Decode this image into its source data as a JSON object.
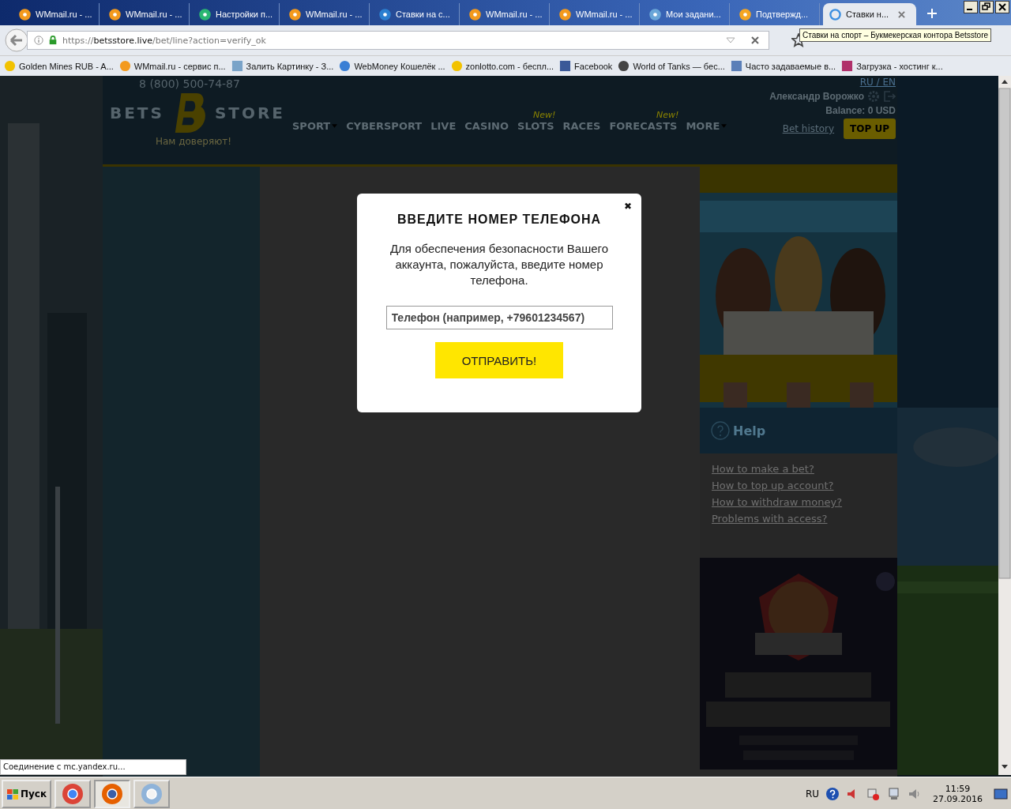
{
  "browser": {
    "tabs": [
      {
        "title": "WMmail.ru - ...",
        "kind": "mail",
        "selected": false
      },
      {
        "title": "WMmail.ru - ...",
        "kind": "mail",
        "selected": false
      },
      {
        "title": "Настройки п...",
        "kind": "paw",
        "selected": false
      },
      {
        "title": "WMmail.ru - ...",
        "kind": "mail",
        "selected": false
      },
      {
        "title": "Ставки на с...",
        "kind": "bets",
        "selected": false
      },
      {
        "title": "WMmail.ru - ...",
        "kind": "mail",
        "selected": false
      },
      {
        "title": "WMmail.ru - ...",
        "kind": "mail",
        "selected": false
      },
      {
        "title": "Мои задани...",
        "kind": "target",
        "selected": false
      },
      {
        "title": "Подтвержд...",
        "kind": "mailbox",
        "selected": false
      },
      {
        "title": "Ставки н...",
        "kind": "loading",
        "selected": true
      }
    ],
    "address": {
      "url": "https://**betsstore.live**/bet/line?action=verify_ok"
    },
    "tooltip": "Ставки на спорт – Букмекерская контора Betsstore",
    "bookmarks": [
      {
        "title": "Golden Mines RUB - A...",
        "kind": "coin"
      },
      {
        "title": "WMmail.ru - сервис п...",
        "kind": "mail"
      },
      {
        "title": "Залить Картинку - З..."
      },
      {
        "title": "WebMoney Кошелёк ...",
        "kind": "globe"
      },
      {
        "title": "zonlotto.com - беспл...",
        "kind": "coin"
      },
      {
        "title": "Facebook",
        "kind": "facebook"
      },
      {
        "title": "World of Tanks — бес...",
        "kind": "shield"
      },
      {
        "title": "Часто задаваемые в...",
        "kind": "columns"
      },
      {
        "title": "Загрузка - хостинг к...",
        "kind": "stripes"
      }
    ],
    "status": "Соединение с mc.yandex.ru..."
  },
  "site": {
    "header": {
      "phone": "8 (800) 500-74-87",
      "logo_left": "BETS",
      "logo_right": "STORE",
      "tagline": "Нам доверяют!",
      "nav": [
        {
          "label": "SPORT",
          "dropdown": true
        },
        {
          "label": "CYBERSPORT",
          "dropdown": false
        },
        {
          "label": "LIVE",
          "dropdown": false
        },
        {
          "label": "CASINO",
          "dropdown": false
        },
        {
          "label": "SLOTS",
          "dropdown": false,
          "badge": "New!"
        },
        {
          "label": "RACES",
          "dropdown": false
        },
        {
          "label": "FORECASTS",
          "dropdown": false,
          "badge": "New!"
        },
        {
          "label": "MORE",
          "dropdown": true
        }
      ],
      "lang_switch": "RU / EN",
      "user": "Александр Ворожко",
      "balance": "Balance: 0 USD",
      "bet_history": "Bet history",
      "top_up": "TOP UP"
    },
    "help": {
      "title": "Help",
      "links": [
        "How to make a bet?",
        "How to top up account?",
        "How to withdraw money?",
        "Problems with access?"
      ]
    }
  },
  "modal": {
    "close": "✖",
    "title": "ВВЕДИТЕ НОМЕР ТЕЛЕФОНА",
    "text": "Для обеспечения безопасности Вашего аккаунта, пожалуйста, введите номер телефона.",
    "placeholder": "Телефон (например, +79601234567)",
    "button": "ОТПРАВИТЬ!"
  },
  "taskbar": {
    "start": "Пуск",
    "apps": [
      {
        "kind": "chrome",
        "selected": false
      },
      {
        "kind": "firefox",
        "selected": true
      },
      {
        "kind": "paint",
        "selected": false
      }
    ],
    "lang": "RU",
    "time": "11:59",
    "date": "27.09.2016"
  }
}
